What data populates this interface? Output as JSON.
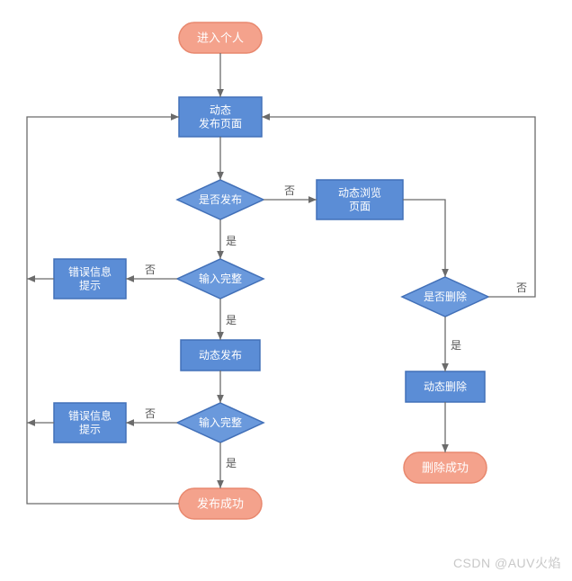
{
  "nodes": {
    "start": "进入个人",
    "page_publish": [
      "动态",
      "发布页面"
    ],
    "decide_publish": "是否发布",
    "page_browse": [
      "动态浏览",
      "页面"
    ],
    "decide_complete_1": "输入完整",
    "error_1": [
      "错误信息",
      "提示"
    ],
    "action_publish": "动态发布",
    "decide_complete_2": "输入完整",
    "error_2": [
      "错误信息",
      "提示"
    ],
    "end_publish": "发布成功",
    "decide_delete": "是否删除",
    "action_delete": "动态删除",
    "end_delete": "删除成功"
  },
  "labels": {
    "yes": "是",
    "no": "否"
  },
  "colors": {
    "terminal_fill": "#f4a28c",
    "terminal_stroke": "#e8886e",
    "process_fill": "#5b8dd6",
    "process_stroke": "#4270b8",
    "decision_fill": "#6a99dc",
    "decision_stroke": "#4270b8",
    "edge": "#6b6b6b",
    "white": "#ffffff",
    "label": "#555555"
  },
  "watermark": "CSDN @AUV火焰"
}
